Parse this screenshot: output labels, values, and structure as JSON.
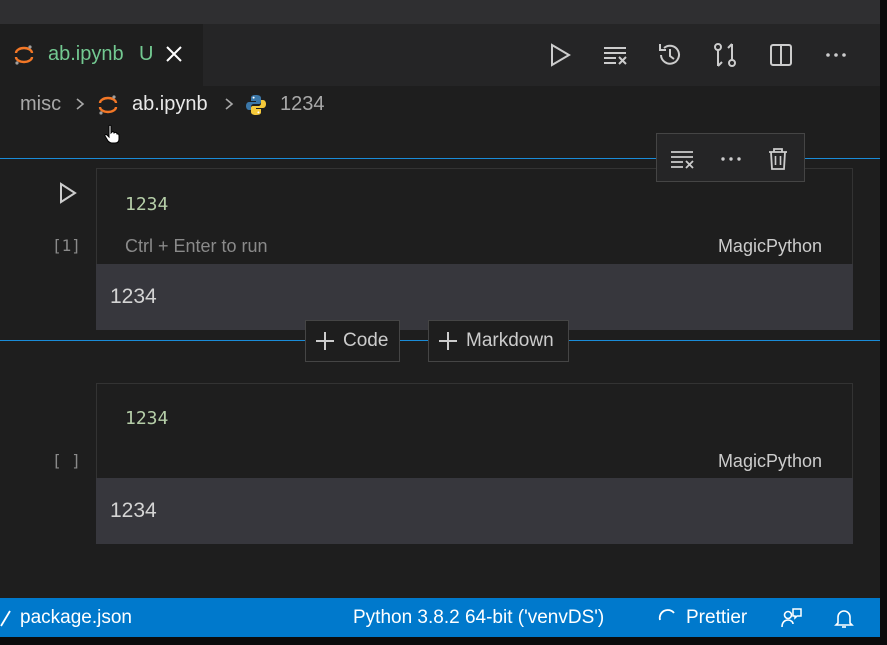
{
  "tab": {
    "title": "ab.ipynb",
    "status": "U"
  },
  "breadcrumb": {
    "folder": "misc",
    "file": "ab.ipynb",
    "symbol": "1234"
  },
  "cells": [
    {
      "source": "1234",
      "execution_count": "[1]",
      "hint": "Ctrl + Enter to run",
      "language": "MagicPython",
      "output": "1234"
    },
    {
      "source": "1234",
      "execution_count": "[ ]",
      "language": "MagicPython",
      "output": "1234"
    }
  ],
  "add_cell": {
    "code_label": "Code",
    "markdown_label": "Markdown"
  },
  "statusbar": {
    "left_item": "package.json",
    "interpreter": "Python 3.8.2 64-bit ('venvDS')",
    "formatter": "Prettier"
  },
  "icons": {
    "jupyter": "jupyter-icon",
    "python": "python-icon",
    "run_all": "run-all-icon",
    "clear_outputs": "clear-outputs-icon",
    "restart": "restart-kernel-icon",
    "variables": "variables-icon",
    "split": "split-editor-icon",
    "more": "more-actions-icon",
    "delete": "trash-icon",
    "feedback": "feedback-icon",
    "bell": "bell-icon"
  },
  "colors": {
    "accent": "#0079cc",
    "focus": "#1a8cd8",
    "modified": "#73c991",
    "code_number": "#b5cea8",
    "jupyter_orange": "#f37726"
  }
}
